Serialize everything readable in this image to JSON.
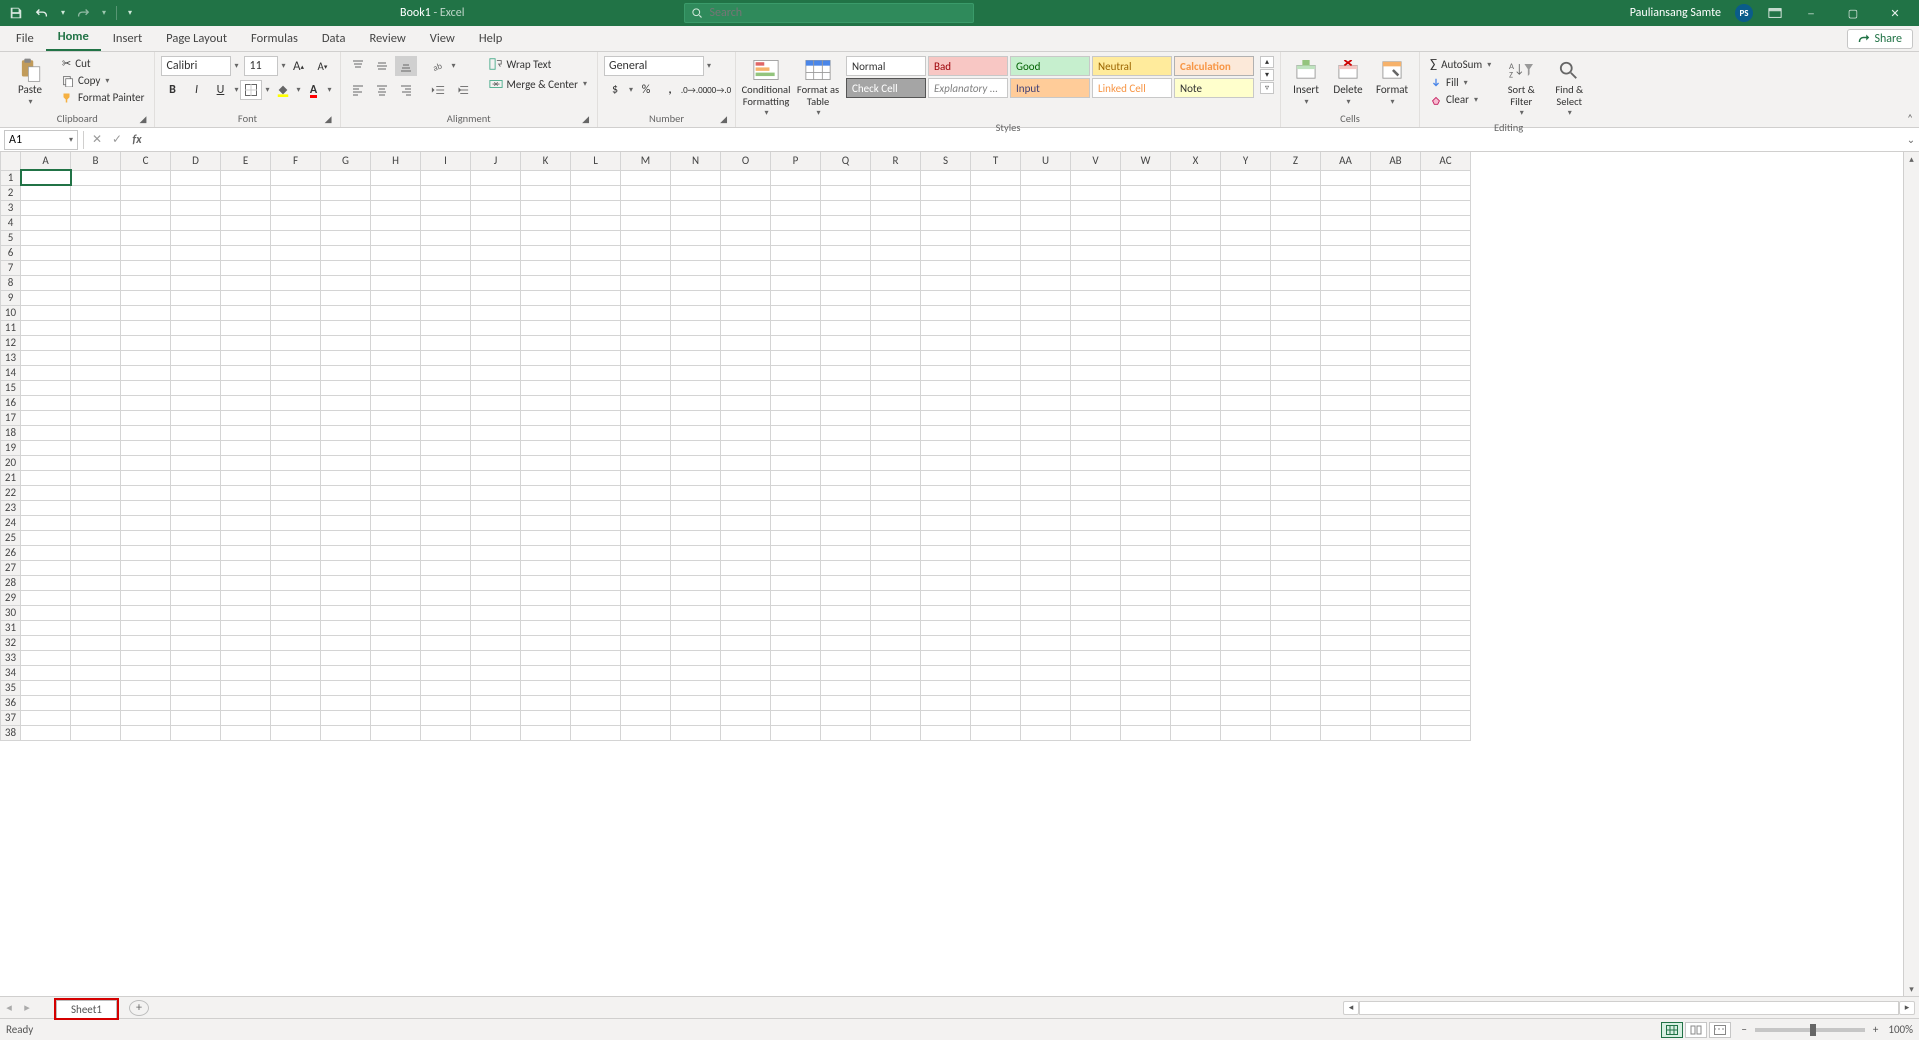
{
  "title": {
    "doc": "Book1",
    "sep": "  -  ",
    "app": "Excel"
  },
  "search": {
    "placeholder": "Search"
  },
  "user": {
    "name": "Pauliansang Samte",
    "initials": "PS"
  },
  "tabs": [
    "File",
    "Home",
    "Insert",
    "Page Layout",
    "Formulas",
    "Data",
    "Review",
    "View",
    "Help"
  ],
  "active_tab": "Home",
  "share": "Share",
  "ribbon": {
    "clipboard": {
      "paste": "Paste",
      "cut": "Cut",
      "copy": "Copy",
      "painter": "Format Painter",
      "label": "Clipboard"
    },
    "font": {
      "name": "Calibri",
      "size": "11",
      "label": "Font"
    },
    "alignment": {
      "wrap": "Wrap Text",
      "merge": "Merge & Center",
      "label": "Alignment"
    },
    "number": {
      "format": "General",
      "label": "Number"
    },
    "styles": {
      "cond": "Conditional Formatting",
      "fat": "Format as Table",
      "cells": [
        "Normal",
        "Bad",
        "Good",
        "Neutral",
        "Calculation",
        "Check Cell",
        "Explanatory ...",
        "Input",
        "Linked Cell",
        "Note"
      ],
      "label": "Styles"
    },
    "cells": {
      "insert": "Insert",
      "delete": "Delete",
      "format": "Format",
      "label": "Cells"
    },
    "editing": {
      "autosum": "AutoSum",
      "fill": "Fill",
      "clear": "Clear",
      "sort": "Sort & Filter",
      "find": "Find & Select",
      "label": "Editing"
    }
  },
  "namebox": "A1",
  "columns": [
    "A",
    "B",
    "C",
    "D",
    "E",
    "F",
    "G",
    "H",
    "I",
    "J",
    "K",
    "L",
    "M",
    "N",
    "O",
    "P",
    "Q",
    "R",
    "S",
    "T",
    "U",
    "V",
    "W",
    "X",
    "Y",
    "Z",
    "AA",
    "AB",
    "AC"
  ],
  "rows": 38,
  "selected_cell": "A1",
  "sheet_tab": "Sheet1",
  "status": {
    "ready": "Ready",
    "zoom": "100%"
  }
}
